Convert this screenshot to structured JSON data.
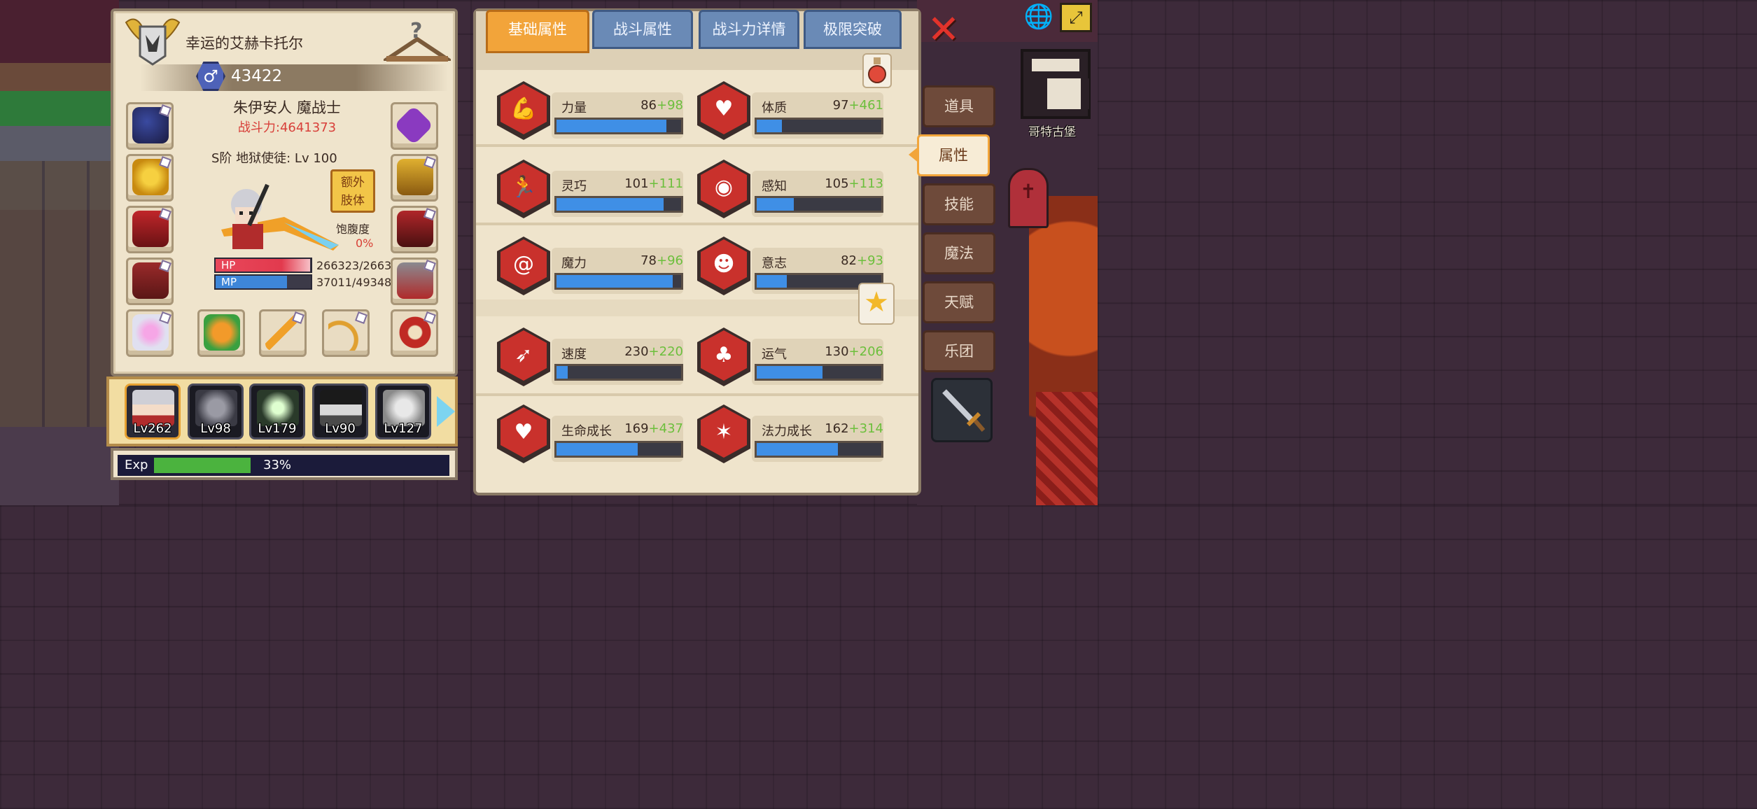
{
  "character": {
    "name": "幸运的艾赫卡托尔",
    "power": "43422",
    "race_class": "朱伊安人 魔战士",
    "battle_power": "战斗力:4641373",
    "rank_line": "S阶 地狱使徒: Lv 100",
    "extra_limb_label_1": "额外",
    "extra_limb_label_2": "肢体",
    "hunger_label": "饱腹度",
    "hunger_value": "0%",
    "hp_tag": "HP",
    "hp_text": "266323/2663",
    "hp_fraction": 0.99,
    "mp_tag": "MP",
    "mp_text": "37011/49348",
    "mp_fraction": 0.75
  },
  "party": [
    {
      "label": "Lv262",
      "active": true
    },
    {
      "label": "Lv98"
    },
    {
      "label": "Lv179"
    },
    {
      "label": "Lv90"
    },
    {
      "label": "Lv127"
    }
  ],
  "exp": {
    "label": "Exp",
    "percent": "33%",
    "fraction": 0.33
  },
  "tabs": [
    {
      "label": "基础属性",
      "active": true
    },
    {
      "label": "战斗属性"
    },
    {
      "label": "战斗力详情"
    },
    {
      "label": "极限突破"
    }
  ],
  "stats": [
    {
      "name": "力量",
      "base": "86",
      "bonus": "+98",
      "fill": 0.88,
      "icon": "muscle-icon"
    },
    {
      "name": "体质",
      "base": "97",
      "bonus": "+461",
      "fill": 0.2,
      "icon": "body-icon"
    },
    {
      "name": "灵巧",
      "base": "101",
      "bonus": "+111",
      "fill": 0.86,
      "icon": "runner-icon"
    },
    {
      "name": "感知",
      "base": "105",
      "bonus": "+113",
      "fill": 0.3,
      "icon": "eye-icon"
    },
    {
      "name": "魔力",
      "base": "78",
      "bonus": "+96",
      "fill": 0.93,
      "icon": "swirl-icon"
    },
    {
      "name": "意志",
      "base": "82",
      "bonus": "+93",
      "fill": 0.24,
      "icon": "head-icon"
    },
    {
      "name": "速度",
      "base": "230",
      "bonus": "+220",
      "fill": 0.09,
      "icon": "wing-icon"
    },
    {
      "name": "运气",
      "base": "130",
      "bonus": "+206",
      "fill": 0.53,
      "icon": "clover-icon"
    },
    {
      "name": "生命成长",
      "base": "169",
      "bonus": "+437",
      "fill": 0.65,
      "icon": "heart-icon"
    },
    {
      "name": "法力成长",
      "base": "162",
      "bonus": "+314",
      "fill": 0.65,
      "icon": "star-rune-icon"
    }
  ],
  "side_menu": [
    {
      "label": "道具"
    },
    {
      "label": "属性",
      "active": true
    },
    {
      "label": "技能"
    },
    {
      "label": "魔法"
    },
    {
      "label": "天赋"
    },
    {
      "label": "乐团"
    }
  ],
  "world": {
    "location_label": "哥特古堡"
  },
  "colors": {
    "hex_red": "#c9312c",
    "bar_blue": "#3f8fe6",
    "bonus_green": "#6cbf3c",
    "tab_active": "#f2a43a",
    "tab_inactive": "#6a8ab6"
  }
}
